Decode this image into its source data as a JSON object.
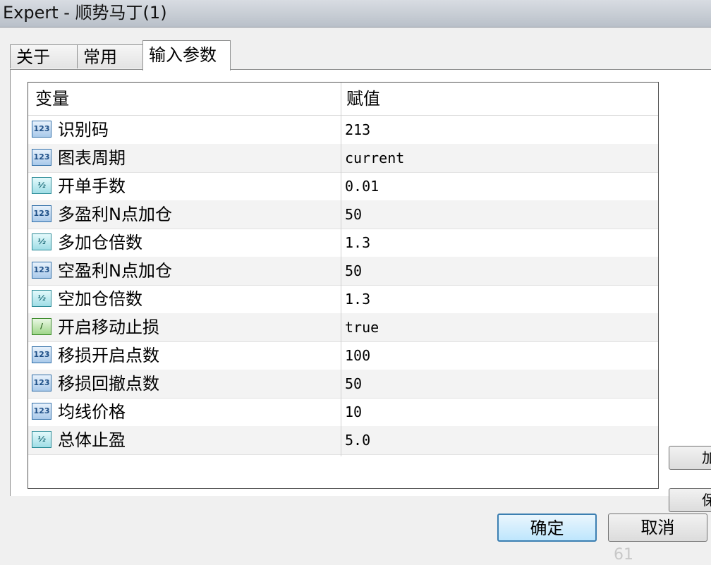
{
  "window": {
    "title": "Expert - 顺势马丁(1)"
  },
  "tabs": [
    {
      "label": "关于"
    },
    {
      "label": "常用"
    },
    {
      "label": "输入参数"
    }
  ],
  "table": {
    "headers": {
      "variable": "变量",
      "value": "赋值"
    },
    "rows": [
      {
        "icon": "int-icon",
        "icon_text": "123",
        "name": "识别码",
        "value": "213"
      },
      {
        "icon": "int-icon",
        "icon_text": "123",
        "name": "图表周期",
        "value": "current"
      },
      {
        "icon": "double-icon",
        "icon_text": "½",
        "name": "开单手数",
        "value": "0.01"
      },
      {
        "icon": "int-icon",
        "icon_text": "123",
        "name": "多盈利N点加仓",
        "value": "50"
      },
      {
        "icon": "double-icon",
        "icon_text": "½",
        "name": "多加仓倍数",
        "value": "1.3"
      },
      {
        "icon": "int-icon",
        "icon_text": "123",
        "name": "空盈利N点加仓",
        "value": "50"
      },
      {
        "icon": "double-icon",
        "icon_text": "½",
        "name": "空加仓倍数",
        "value": "1.3"
      },
      {
        "icon": "bool-icon",
        "icon_text": "/",
        "name": "开启移动止损",
        "value": "true"
      },
      {
        "icon": "int-icon",
        "icon_text": "123",
        "name": "移损开启点数",
        "value": "100"
      },
      {
        "icon": "int-icon",
        "icon_text": "123",
        "name": "移损回撤点数",
        "value": "50"
      },
      {
        "icon": "int-icon",
        "icon_text": "123",
        "name": "均线价格",
        "value": "10"
      },
      {
        "icon": "double-icon",
        "icon_text": "½",
        "name": "总体止盈",
        "value": "5.0"
      }
    ]
  },
  "side_buttons": [
    {
      "label": "加"
    },
    {
      "label": "保"
    }
  ],
  "buttons": {
    "ok": "确定",
    "cancel": "取消"
  },
  "watermark": "61"
}
